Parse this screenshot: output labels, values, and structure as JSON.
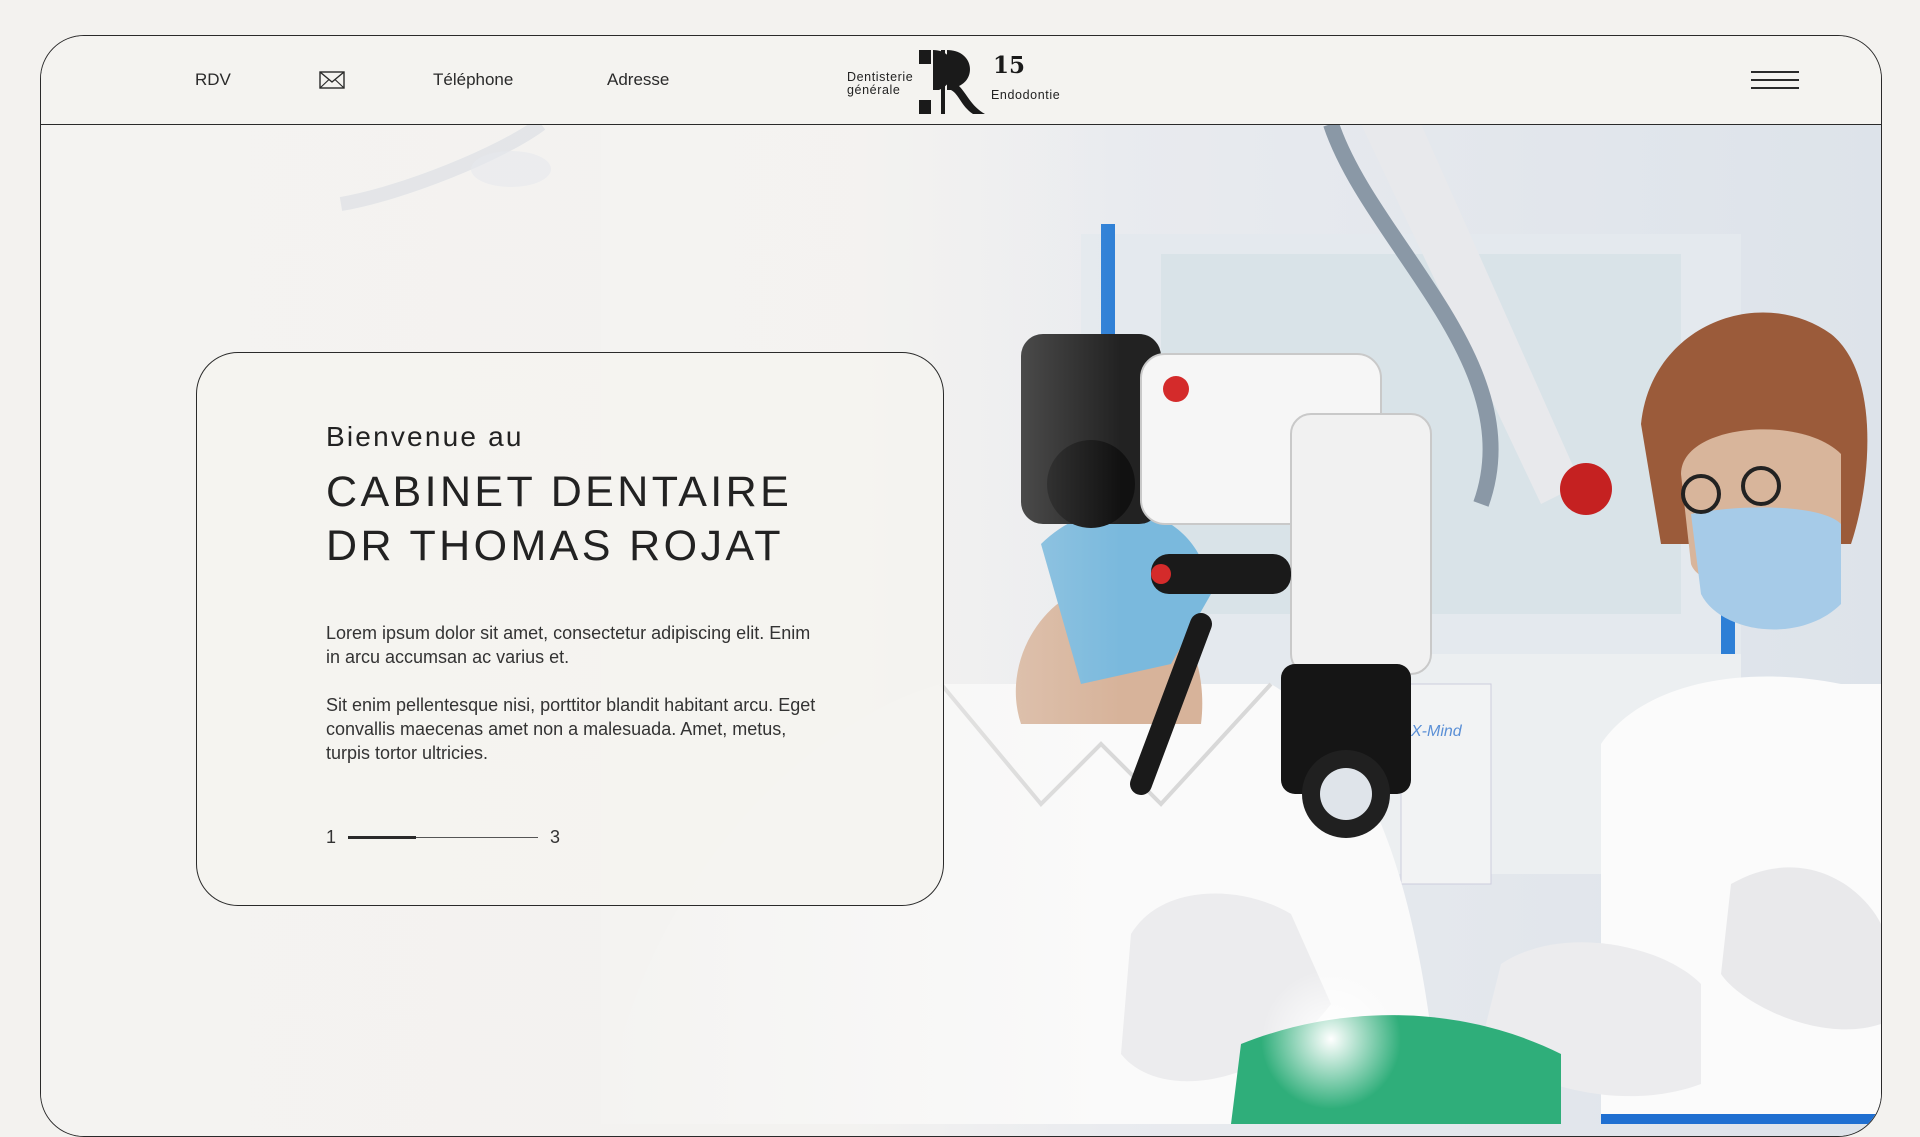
{
  "nav": {
    "rdv": "RDV",
    "mail_icon": "mail-icon",
    "telephone": "Téléphone",
    "adresse": "Adresse"
  },
  "logo": {
    "left_line1": "Dentisterie",
    "left_line2": "générale",
    "number": "15",
    "right_text": "Endodontie"
  },
  "menu_icon": "hamburger-menu-icon",
  "hero": {
    "eyebrow": "Bienvenue au",
    "title_line1": "CABINET DENTAIRE",
    "title_line2": "DR THOMAS ROJAT",
    "paragraph1": "Lorem ipsum dolor sit amet, consectetur adipiscing elit. Enim in arcu accumsan ac varius et.",
    "paragraph2": "Sit enim pellentesque nisi, porttitor blandit habitant arcu. Eget convallis maecenas amet non a malesuada. Amet, metus, turpis tortor ultricies.",
    "pager_current": "1",
    "pager_total": "3",
    "pager_progress": 0.36
  },
  "photo": {
    "label": "X-Mind"
  }
}
